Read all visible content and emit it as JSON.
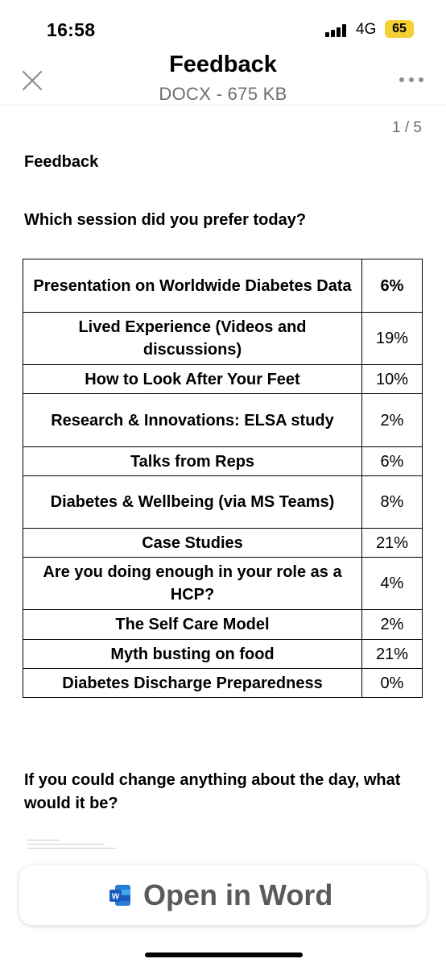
{
  "status_bar": {
    "time": "16:58",
    "network": "4G",
    "battery": "65"
  },
  "header": {
    "title": "Feedback",
    "subtitle": "DOCX - 675 KB"
  },
  "page_indicator": "1 / 5",
  "document": {
    "heading": "Feedback",
    "question_1": "Which session did you prefer today?",
    "rows": [
      {
        "session": "Presentation on Worldwide Diabetes Data",
        "percent": "6%"
      },
      {
        "session": "Lived Experience (Videos and discussions)",
        "percent": "19%"
      },
      {
        "session": "How to Look After Your Feet",
        "percent": "10%"
      },
      {
        "session": "Research & Innovations: ELSA study",
        "percent": "2%"
      },
      {
        "session": "Talks from Reps",
        "percent": "6%"
      },
      {
        "session": "Diabetes & Wellbeing (via MS Teams)",
        "percent": "8%"
      },
      {
        "session": "Case Studies",
        "percent": "21%"
      },
      {
        "session": "Are you doing enough in your role as a HCP?",
        "percent": "4%"
      },
      {
        "session": "The Self Care Model",
        "percent": "2%"
      },
      {
        "session": "Myth busting on food",
        "percent": "21%"
      },
      {
        "session": "Diabetes Discharge Preparedness",
        "percent": "0%"
      }
    ],
    "question_2": "If you could change anything about the day, what would it be?"
  },
  "open_button": {
    "label": "Open in Word",
    "icon": "word-icon",
    "icon_color": "#185abd"
  }
}
